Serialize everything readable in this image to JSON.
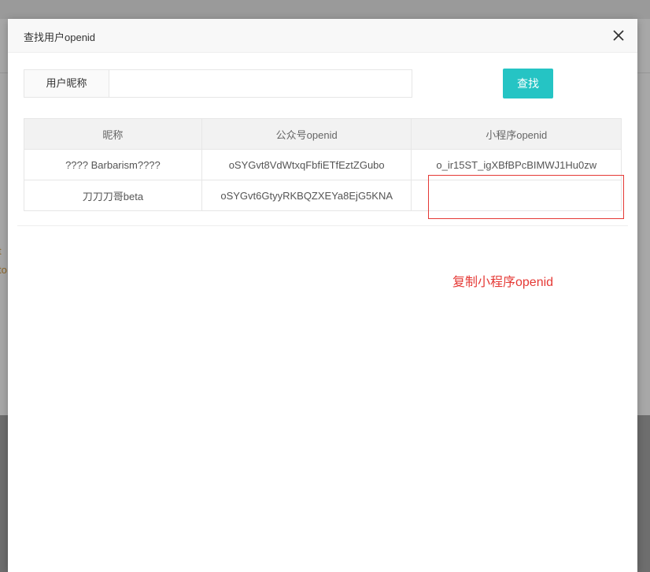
{
  "background": {
    "fragment_1": "t",
    "fragment_2": "to"
  },
  "dialog": {
    "title": "查找用户openid",
    "close_icon": "close-icon"
  },
  "search": {
    "label": "用户昵称",
    "input_value": "",
    "button_label": "查找"
  },
  "table": {
    "headers": [
      "昵称",
      "公众号openid",
      "小程序openid"
    ],
    "rows": [
      [
        "???? Barbarism????",
        "oSYGvt8VdWtxqFbfiETfEztZGubo",
        "o_ir15ST_igXBfBPcBIMWJ1Hu0zw"
      ],
      [
        "刀刀刀哥beta",
        "oSYGvt6GtyyRKBQZXEYa8EjG5KNA",
        ""
      ]
    ]
  },
  "annotation": {
    "text": "复制小程序openid",
    "color": "#e53935"
  },
  "colors": {
    "accent": "#25c4c4",
    "annotation_red": "#e53935"
  }
}
